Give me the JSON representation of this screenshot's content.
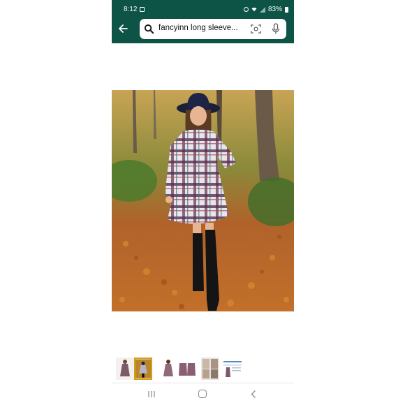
{
  "status_bar": {
    "time": "8:12",
    "battery": "83%"
  },
  "search": {
    "query": "fancyinn long sleeve..."
  },
  "icons": {
    "back": "back-arrow-icon",
    "search": "search-icon",
    "lens": "camera-lens-icon",
    "mic": "microphone-icon",
    "status_image": "image-icon",
    "alarm": "alarm-icon",
    "wifi": "wifi-icon",
    "signal": "signal-icon",
    "battery": "battery-icon",
    "nav_recent": "recent-apps-icon",
    "nav_home": "home-icon",
    "nav_back": "nav-back-icon"
  },
  "product_image": {
    "subject": "plaid tiered dress outfit photo"
  },
  "thumbnails": {
    "count": 6,
    "selected_index": 1
  },
  "colors": {
    "header": "#0d5446",
    "selected_thumb_border": "#d4a017"
  }
}
